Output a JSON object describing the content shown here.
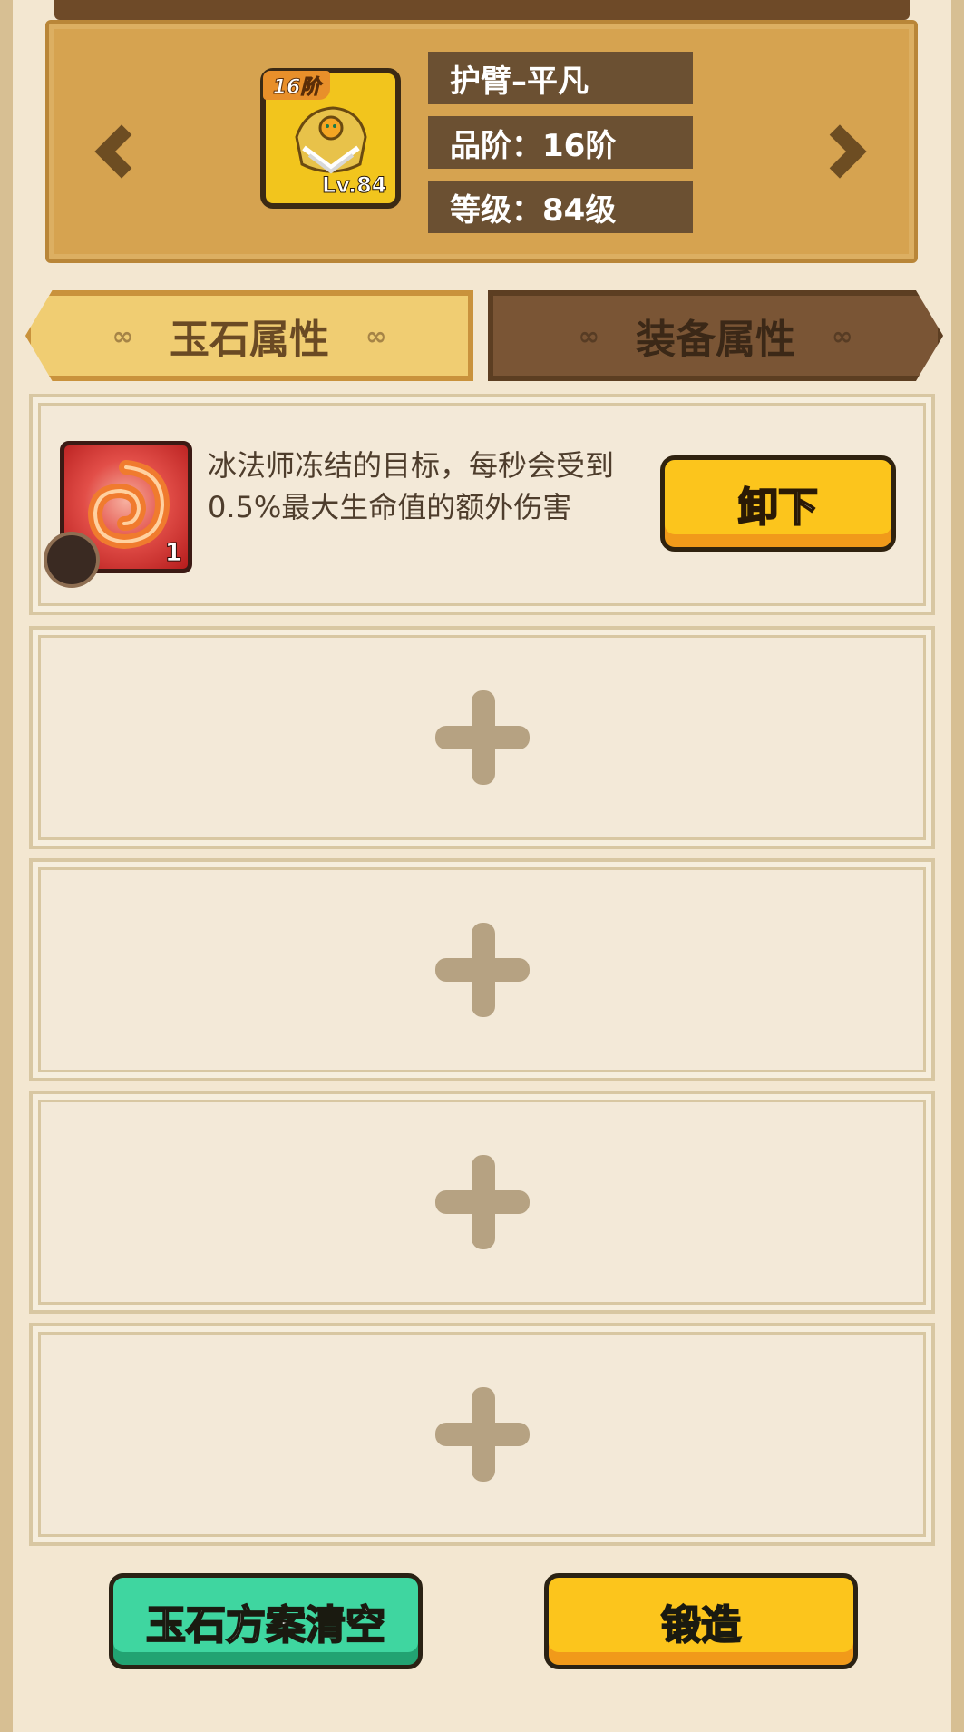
{
  "header": {
    "item_name": "护臂–平凡",
    "grade_label": "品阶：",
    "grade_value": "16阶",
    "level_label": "等级：",
    "level_value": "84级",
    "tier_badge": "16阶",
    "item_level": "Lv.84"
  },
  "tabs": [
    {
      "label": "玉石属性",
      "active": true
    },
    {
      "label": "装备属性",
      "active": false
    }
  ],
  "slots": [
    {
      "filled": true,
      "gem_count": "1",
      "description": "冰法师冻结的目标，每秒会受到0.5%最大生命值的额外伤害",
      "action_label": "卸下"
    },
    {
      "filled": false
    },
    {
      "filled": false
    },
    {
      "filled": false
    },
    {
      "filled": false
    }
  ],
  "buttons": {
    "clear_label": "玉石方案清空",
    "forge_label": "锻造"
  },
  "icons": {
    "prev": "chevron-left-icon",
    "next": "chevron-right-icon",
    "add": "plus-icon",
    "gem": "spiral-gem-icon"
  }
}
